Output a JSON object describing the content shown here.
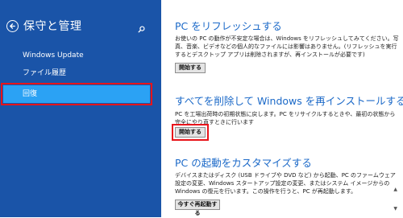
{
  "sidebar": {
    "title": "保守と管理",
    "items": [
      {
        "label": "Windows Update"
      },
      {
        "label": "ファイル履歴"
      },
      {
        "label": "回復"
      }
    ]
  },
  "main": {
    "sections": [
      {
        "title": "PC をリフレッシュする",
        "desc": "お使いの PC の動作が不安定な場合は、Windows をリフレッシュしてみてください。写真、音楽、ビデオなどの個人的なファイルには影響はありません。(リフレッシュを実行するとデスクトップ アプリは削除されますが、再インストールが必要です)",
        "button": "開始する"
      },
      {
        "title": "すべてを削除して Windows を再インストールする",
        "desc": "PC を工場出荷時の初期状態に戻します。PC をリサイクルするときや、最初の状態から完全にやり直すときに行います",
        "button": "開始する"
      },
      {
        "title": "PC の起動をカスタマイズする",
        "desc": "デバイスまたはディスク (USB ドライブや DVD など) から起動、PC のファームウェア設定の変更、Windows スタートアップ設定の変更、またはシステム イメージからの Windows の復元を行います。この操作を行うと、PC が再起動します。",
        "button": "今すぐ再起動する"
      }
    ]
  },
  "colors": {
    "sidebar_bg": "#1a54a8",
    "selected_bg": "#2ba2f4",
    "highlight_border": "#e8141a",
    "title_text": "#1b69c8"
  },
  "icons": {
    "back": "back-arrow-icon",
    "search": "search-icon"
  }
}
